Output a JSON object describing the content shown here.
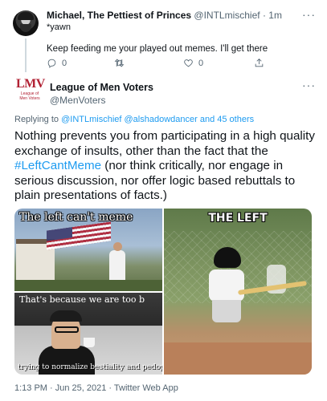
{
  "reply_tweet": {
    "display_name": "Michael, The Pettiest of Princes",
    "handle": "@INTLmischief",
    "time": "1m",
    "header_sep": " · ",
    "subline": "*yawn",
    "text": "Keep feeding me your played out memes. I'll get there",
    "more": "···",
    "actions": {
      "reply_count": "0",
      "retweet_count": "",
      "like_count": "0"
    }
  },
  "main_tweet": {
    "display_name": "League of Men Voters",
    "handle": "@MenVoters",
    "more": "···",
    "avatar": {
      "logo_text": "LMV",
      "logo_sub": "League of Men Voters"
    },
    "replying_prefix": "Replying to ",
    "replying_to": "@INTLmischief @alshadowdancer and 45 others",
    "text_part1": "Nothing prevents you from participating in a high quality exchange of insults, other than the fact that the ",
    "hashtag": "#LeftCantMeme",
    "text_part2": " (nor think critically, nor engage in serious discussion, nor offer logic based rebuttals to plain presentations of facts.)",
    "media": {
      "top_left_caption": "The left can't meme",
      "bottom_left_caption": "That's because we are too b",
      "bottom_left_subcaption": "trying to normalize bestiality and pedop",
      "right_caption": "THE LEFT"
    },
    "timestamp": "1:13 PM · Jun 25, 2021 · Twitter Web App"
  },
  "colors": {
    "link": "#1d9bf0",
    "secondary_text": "#536471",
    "primary_text": "#0f1419"
  },
  "icons": [
    "reply-icon",
    "retweet-icon",
    "like-icon",
    "share-icon",
    "more-icon"
  ]
}
